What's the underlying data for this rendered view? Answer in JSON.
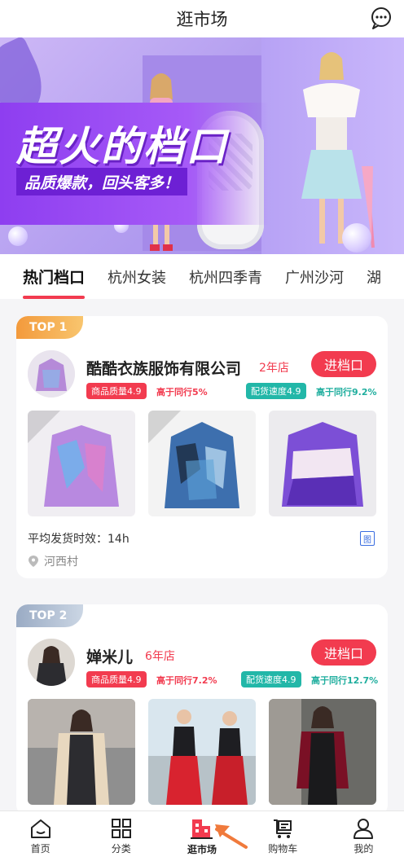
{
  "header": {
    "title": "逛市场",
    "message_icon": "chat-bubble-icon"
  },
  "banner": {
    "headline": "超火的档口",
    "subline": "品质爆款，回头客多！",
    "colors": {
      "purple": "#a65af7",
      "deep_purple": "#6d20d4"
    }
  },
  "tabs": [
    {
      "label": "热门档口",
      "active": true
    },
    {
      "label": "杭州女装",
      "active": false
    },
    {
      "label": "杭州四季青",
      "active": false
    },
    {
      "label": "广州沙河",
      "active": false
    },
    {
      "label": "湖",
      "active": false
    }
  ],
  "shops": [
    {
      "rank": "TOP 1",
      "name": "酷酷衣族服饰有限公司",
      "years": "2年店",
      "enter_label": "进档口",
      "quality_badge": "商品质量4.9",
      "quality_compare": "高于同行5%",
      "speed_badge": "配货速度4.9",
      "speed_compare": "高于同行9.2%",
      "ship_time": "平均发货时效：14h",
      "location": "河西村",
      "img_label": "图"
    },
    {
      "rank": "TOP 2",
      "name": "婵米儿",
      "years": "6年店",
      "enter_label": "进档口",
      "quality_badge": "商品质量4.9",
      "quality_compare": "高于同行7.2%",
      "speed_badge": "配货速度4.9",
      "speed_compare": "高于同行12.7%"
    }
  ],
  "nav": [
    {
      "label": "首页",
      "icon": "home-icon"
    },
    {
      "label": "分类",
      "icon": "grid-icon"
    },
    {
      "label": "逛市场",
      "icon": "market-icon",
      "active": true
    },
    {
      "label": "购物车",
      "icon": "cart-icon"
    },
    {
      "label": "我的",
      "icon": "user-icon"
    }
  ],
  "colors": {
    "accent": "#f23b4f",
    "teal": "#22b7a8",
    "gold": "#f39a3c"
  }
}
